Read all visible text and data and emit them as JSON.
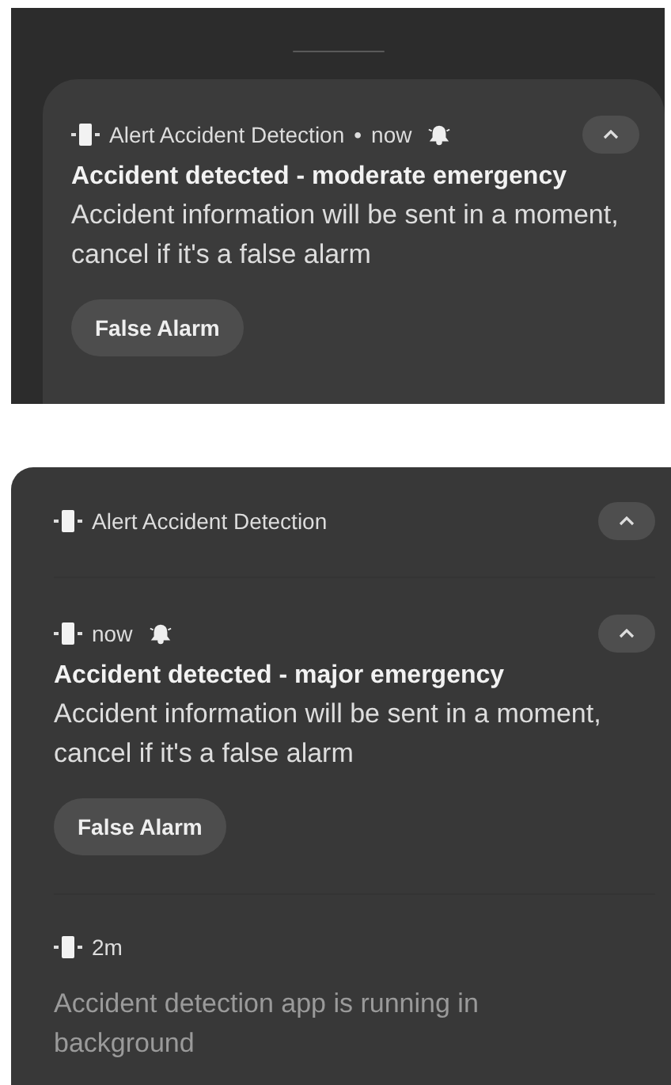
{
  "single_notification": {
    "app_name": "Alert Accident Detection",
    "separator": "•",
    "time": "now",
    "alarm": true,
    "expanded": true,
    "title": "Accident detected - moderate emergency",
    "body": "Accident information will be sent in a moment, cancel if it's a false alarm",
    "action": "False Alarm"
  },
  "group": {
    "app_name": "Alert Accident Detection",
    "expanded": true,
    "notifications": [
      {
        "kind": "alert",
        "time": "now",
        "alarm": true,
        "expanded": true,
        "title": "Accident detected - major emergency",
        "body": "Accident information will be sent in a moment, cancel if it's a false alarm",
        "action": "False Alarm"
      },
      {
        "kind": "status",
        "time": "2m",
        "body": "Accident detection app is running in background"
      }
    ]
  }
}
